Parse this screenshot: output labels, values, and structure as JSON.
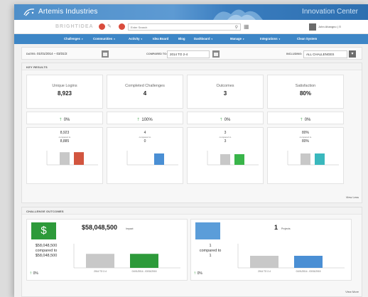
{
  "header": {
    "brand": "Artemis Industries",
    "center": "Innovation Center"
  },
  "util": {
    "brand_text": "BRIGHTIDEA",
    "search_placeholder": "Enter Search",
    "user": "John Ahangno | ⊙"
  },
  "nav": {
    "items": [
      {
        "label": "Challenges",
        "caret": "▾"
      },
      {
        "label": "Communities",
        "caret": "▾"
      },
      {
        "label": "Activity",
        "caret": "▾"
      },
      {
        "label": "Idea Board",
        "caret": ""
      },
      {
        "label": "Blog",
        "caret": ""
      },
      {
        "label": "Dashboard",
        "caret": "▾"
      },
      {
        "label": "Manage",
        "caret": "▾"
      },
      {
        "label": "Integrations",
        "caret": "▾"
      },
      {
        "label": "Clean System",
        "caret": ""
      }
    ]
  },
  "filters": {
    "dates_label": "DATES:",
    "dates_value": "01/01/2014 – 03/31/2",
    "compared_label": "COMPARED TO:",
    "compared_value": "2014 TO 2-4",
    "includes_label": "INCLUDING:",
    "includes_value": "ALL CHALLENGES"
  },
  "key_results": {
    "title": "KEY RESULTS",
    "kpis": [
      {
        "title": "Unique Logins",
        "value": "8,923",
        "change": "0%",
        "mini_value": "8,923",
        "compared_label": "compared to",
        "compared_value": "8,885",
        "bars": [
          8885,
          8923
        ],
        "ylim": [
          0,
          10000
        ]
      },
      {
        "title": "Completed Challenges",
        "value": "4",
        "change": "100%",
        "mini_value": "4",
        "compared_label": "compared to",
        "compared_value": "0",
        "bars": [
          0,
          4
        ],
        "ylim": [
          0,
          5
        ]
      },
      {
        "title": "Outcomes",
        "value": "3",
        "change": "0%",
        "mini_value": "3",
        "compared_label": "compared to",
        "compared_value": "3",
        "bars": [
          3,
          3
        ],
        "ylim": [
          0,
          4
        ]
      },
      {
        "title": "Satisfaction",
        "value": "80%",
        "change": "0%",
        "mini_value": "80%",
        "compared_label": "compared to",
        "compared_value": "80%",
        "bars": [
          80,
          80
        ],
        "ylim": [
          0,
          100
        ]
      }
    ],
    "bar_colors": [
      [
        "#c8c8c8",
        "#d2553f"
      ],
      [
        "#c8c8c8",
        "#4a8fd4"
      ],
      [
        "#c8c8c8",
        "#39b54a"
      ],
      [
        "#c8c8c8",
        "#3ab8bd"
      ]
    ],
    "view_less": "View Less"
  },
  "outcomes": {
    "title": "CHALLENGE OUTCOMES",
    "impact": {
      "headline": "$58,048,500",
      "sub": "Impact",
      "left_value": "$58,048,500",
      "compared_label": "compared to",
      "compared_value": "$58,048,500",
      "change": "0%",
      "icon": "dollar-icon",
      "icon_color": "#2d9a3a",
      "bars": [
        58048500,
        58048500
      ],
      "categories": [
        "2014 TO 2-4",
        "01/01/2014 - 03/31/2015"
      ],
      "ylim": [
        0,
        100000000
      ],
      "colors": [
        "#c8c8c8",
        "#2d9a3a"
      ]
    },
    "projects": {
      "headline": "1",
      "sub": "Projects",
      "left_value": "1",
      "compared_label": "compared to",
      "compared_value": "1",
      "change": "0%",
      "icon": "sort-icon",
      "icon_color": "#5b9dd9",
      "bars": [
        1,
        1
      ],
      "categories": [
        "2014 TO 2-4",
        "01/01/2014 - 03/31/2015"
      ],
      "ylim": [
        0,
        2
      ],
      "colors": [
        "#c8c8c8",
        "#4a8fd4"
      ]
    },
    "view_more": "View More"
  }
}
